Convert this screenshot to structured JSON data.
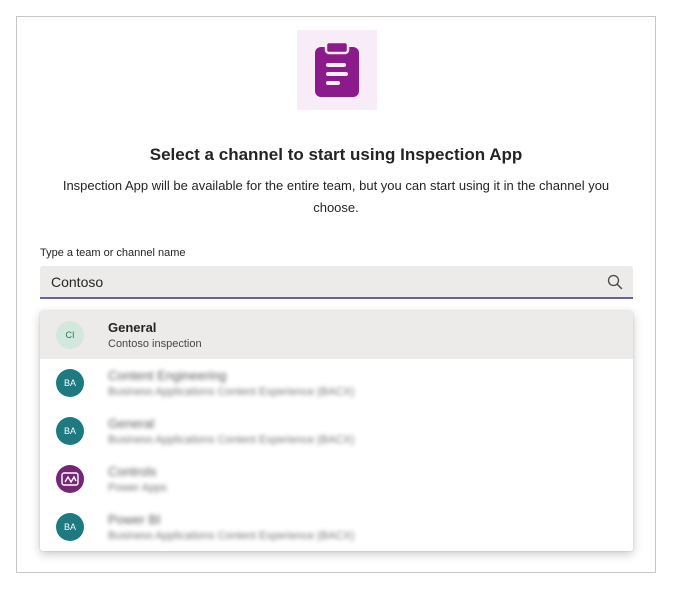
{
  "dialog": {
    "title": "Select a channel to start using Inspection App",
    "subtitle": "Inspection App will be available for the entire team, but you can start using it in the channel you choose.",
    "field_label": "Type a team or channel name",
    "search_value": "Contoso"
  },
  "results": [
    {
      "initials": "CI",
      "title": "General",
      "subtitle": "Contoso inspection",
      "avatar_color": "#d3e7df",
      "avatar_text_color": "#237b4b",
      "selected": true
    },
    {
      "initials": "BA",
      "title": "Content Engineering",
      "subtitle": "Business Applications Content Experience (BACX)",
      "avatar_color": "#1c7a80",
      "avatar_text_color": "#ffffff"
    },
    {
      "initials": "BA",
      "title": "General",
      "subtitle": "Business Applications Content Experience (BACX)",
      "avatar_color": "#1c7a80",
      "avatar_text_color": "#ffffff"
    },
    {
      "initials": "",
      "title": "Controls",
      "subtitle": "Power Apps",
      "avatar_color": "#742774",
      "avatar_text_color": "#ffffff",
      "icon": "power-apps-icon"
    },
    {
      "initials": "BA",
      "title": "Power BI",
      "subtitle": "Business Applications Content Experience (BACX)",
      "avatar_color": "#1c7a80",
      "avatar_text_color": "#ffffff"
    }
  ],
  "colors": {
    "accent": "#6264a7",
    "app_icon_bg": "#f7ecf7",
    "app_icon_fg": "#8b1a8b"
  },
  "icons": {
    "app": "clipboard-icon",
    "search": "search-icon"
  }
}
